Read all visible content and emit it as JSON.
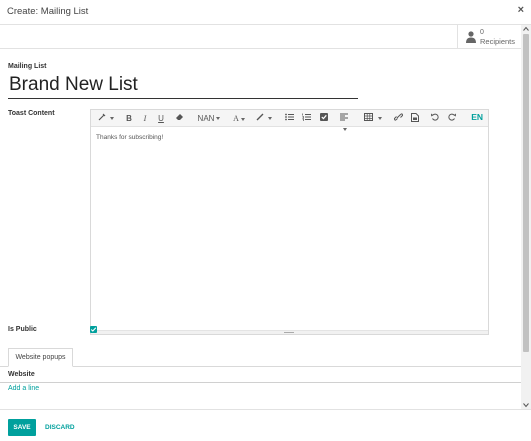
{
  "dialog": {
    "title": "Create: Mailing List",
    "close": "×"
  },
  "stat_button": {
    "count": "0",
    "label": "Recipients",
    "icon": "user-icon"
  },
  "form": {
    "name_label": "Mailing List",
    "name_value": "Brand New List",
    "toast_label": "Toast Content",
    "toast_content": "Thanks for subscribing!",
    "is_public_label": "Is Public",
    "is_public_checked": true
  },
  "toolbar": {
    "style": "style-icon",
    "bold": "B",
    "italic": "I",
    "underline": "U",
    "eraser": "eraser-icon",
    "font_size": "NAN",
    "font_color": "A",
    "background_color": "brush-icon",
    "unordered_list": "unordered-list-icon",
    "ordered_list": "ordered-list-icon",
    "checklist": "checklist-icon",
    "paragraph": "paragraph-icon",
    "table": "table-icon",
    "link": "link-icon",
    "media": "media-icon",
    "undo": "undo-icon",
    "redo": "redo-icon",
    "language": "EN"
  },
  "tabs": [
    {
      "label": "Website popups",
      "active": true
    }
  ],
  "list": {
    "column_header": "Website",
    "add_line": "Add a line"
  },
  "footer": {
    "save_label": "SAVE",
    "discard_label": "DISCARD"
  },
  "colors": {
    "accent": "#00a09d",
    "text": "#4c4c4c"
  }
}
